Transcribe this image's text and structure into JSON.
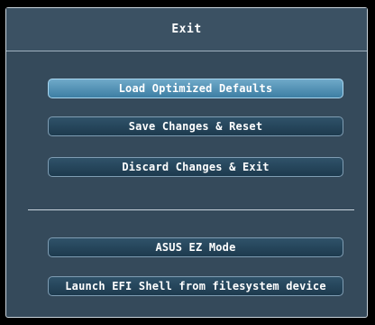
{
  "dialog": {
    "title": "Exit",
    "buttons": [
      {
        "label": "Load Optimized Defaults",
        "selected": true
      },
      {
        "label": "Save Changes & Reset",
        "selected": false
      },
      {
        "label": "Discard Changes & Exit",
        "selected": false
      }
    ],
    "extra_buttons": [
      {
        "label": "ASUS EZ Mode",
        "selected": false
      },
      {
        "label": "Launch EFI Shell from filesystem device",
        "selected": false
      }
    ]
  },
  "colors": {
    "background": "#354a5b",
    "button": "#1d3a4e",
    "button_selected": "#3d7ea3",
    "text": "#ffffff"
  }
}
